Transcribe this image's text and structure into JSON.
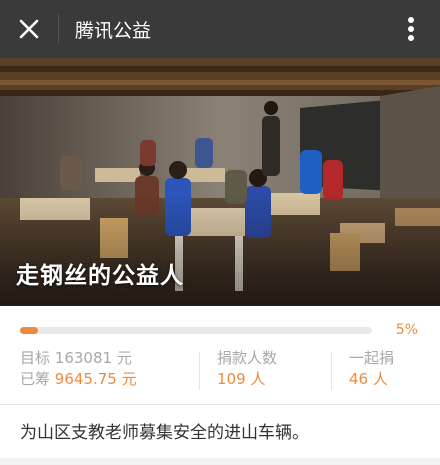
{
  "header": {
    "title": "腾讯公益"
  },
  "hero": {
    "caption": "走钢丝的公益人"
  },
  "progress": {
    "fraction": 0.05,
    "percent_label": "5%"
  },
  "stats": {
    "target_label": "目标",
    "target_value": "163081 元",
    "raised_label": "已筹",
    "raised_value": "9645.75 元",
    "donors_label": "捐款人数",
    "donors_value": "109 人",
    "together_label": "一起捐",
    "together_value": "46 人"
  },
  "description": "为山区支教老师募集安全的进山车辆。",
  "colors": {
    "accent": "#f08a3c",
    "topbar": "#3a3a3a"
  }
}
